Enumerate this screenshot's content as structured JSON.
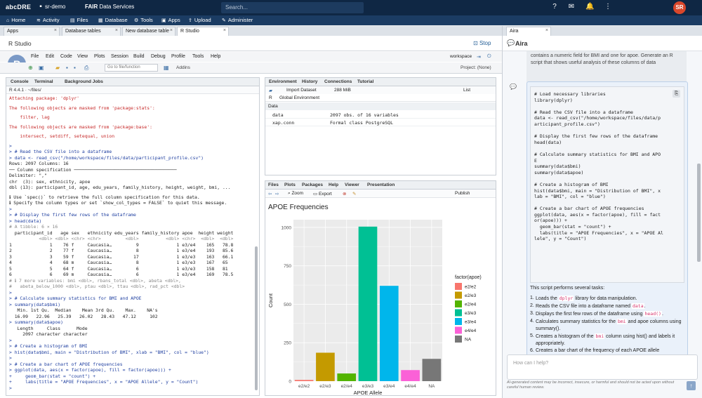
{
  "topbar": {
    "logo": "abcDRE",
    "crumb": "sr-demo",
    "fair_badge": "FAIR",
    "fair_label": "Data Services",
    "search_placeholder": "Search...",
    "avatar_initials": "SR"
  },
  "nav": {
    "items": [
      {
        "label": "Home",
        "icon": "home-icon"
      },
      {
        "label": "Activity",
        "icon": "activity-icon"
      },
      {
        "label": "Files",
        "icon": "files-icon"
      },
      {
        "label": "Database",
        "icon": "database-icon"
      },
      {
        "label": "Tools",
        "icon": "tools-icon"
      },
      {
        "label": "Apps",
        "icon": "apps-icon"
      },
      {
        "label": "Upload",
        "icon": "upload-icon"
      },
      {
        "label": "Administer",
        "icon": "administer-icon"
      }
    ]
  },
  "tabs": [
    {
      "label": "Apps"
    },
    {
      "label": "Database tables"
    },
    {
      "label": "New database table"
    },
    {
      "label": "R Studio"
    }
  ],
  "rstudio": {
    "title": "R Studio",
    "stop_label": "Stop",
    "menu": [
      "File",
      "Edit",
      "Code",
      "View",
      "Plots",
      "Session",
      "Build",
      "Debug",
      "Profile",
      "Tools",
      "Help"
    ],
    "workspace_label": "workspace",
    "goto_placeholder": "Go to file/function",
    "addins_label": "Addins",
    "project_label": "Project: (None)"
  },
  "console": {
    "tabs": [
      "Console",
      "Terminal",
      "Background Jobs"
    ],
    "path": "R 4.4.1 · ~/files/",
    "lines": [
      {
        "t": "Attaching package: 'dplyr'",
        "c": "red"
      },
      {
        "t": "",
        "c": "blank"
      },
      {
        "t": "The following objects are masked from 'package:stats':",
        "c": "red"
      },
      {
        "t": "",
        "c": "blank"
      },
      {
        "t": "    filter, lag",
        "c": "red"
      },
      {
        "t": "",
        "c": "blank"
      },
      {
        "t": "The following objects are masked from 'package:base':",
        "c": "red"
      },
      {
        "t": "",
        "c": "blank"
      },
      {
        "t": "    intersect, setdiff, setequal, union",
        "c": "red"
      },
      {
        "t": "",
        "c": "blank"
      },
      {
        "t": ">",
        "c": "blue"
      },
      {
        "t": "> # Read the CSV file into a dataframe",
        "c": "blue"
      },
      {
        "t": "> data <- read_csv(\"/home/workspace/files/data/participant_profile.csv\")",
        "c": "blue"
      },
      {
        "t": "Rows: 2097 Columns: 16",
        "c": "plain"
      },
      {
        "t": "── Column specification ──────────────────────────────────────",
        "c": "plain"
      },
      {
        "t": "Delimiter: \",\"",
        "c": "plain"
      },
      {
        "t": "chr  (3): sex, ethnicity, apoe",
        "c": "plain"
      },
      {
        "t": "dbl (13): participant_id, age, edu_years, family_history, height, weight, bmi, ...",
        "c": "plain"
      },
      {
        "t": "",
        "c": "blank"
      },
      {
        "t": "ℹ Use `spec()` to retrieve the full column specification for this data.",
        "c": "plain"
      },
      {
        "t": "ℹ Specify the column types or set `show_col_types = FALSE` to quiet this message.",
        "c": "plain"
      },
      {
        "t": ">",
        "c": "blue"
      },
      {
        "t": "> # Display the first few rows of the dataframe",
        "c": "blue"
      },
      {
        "t": "> head(data)",
        "c": "blue"
      },
      {
        "t": "# A tibble: 6 × 16",
        "c": "dim"
      },
      {
        "t": "  participant_id   age sex   ethnicity edu_years family_history apoe  height weight",
        "c": "plain"
      },
      {
        "t": "           <dbl> <dbl> <chr> <chr>         <dbl>          <dbl> <chr>  <dbl>  <dbl>",
        "c": "dim"
      },
      {
        "t": "1              1    76 f     Caucasia…         9              1 e3/e4    165   78.8",
        "c": "plain"
      },
      {
        "t": "2              2    77 f     Caucasia…         8              1 e3/e4    193   85.6",
        "c": "plain"
      },
      {
        "t": "3              3    59 f     Caucasia…        17              1 e3/e3    163   66.1",
        "c": "plain"
      },
      {
        "t": "4              4    68 m     Caucasia…         8              1 e3/e3    167   65",
        "c": "plain"
      },
      {
        "t": "5              5    64 f     Caucasia…         6              1 e3/e3    158   81",
        "c": "plain"
      },
      {
        "t": "6              6    69 m     Caucasia…         6              1 e3/e4    169   78.5",
        "c": "plain"
      },
      {
        "t": "# ℹ 7 more variables: bmi <dbl>, rbans_total <dbl>, abeta <dbl>,",
        "c": "dim"
      },
      {
        "t": "#   abeta_below_1000 <dbl>, ptau <dbl>, ttau <dbl>, rad_pct <dbl>",
        "c": "dim"
      },
      {
        "t": ">",
        "c": "blue"
      },
      {
        "t": "> # Calculate summary statistics for BMI and APOE",
        "c": "blue"
      },
      {
        "t": "> summary(data$bmi)",
        "c": "blue"
      },
      {
        "t": "   Min. 1st Qu.  Median    Mean 3rd Qu.    Max.    NA's",
        "c": "plain"
      },
      {
        "t": "  16.09   22.96   25.39   26.02   28.43   47.12     102",
        "c": "plain"
      },
      {
        "t": "> summary(data$apoe)",
        "c": "blue"
      },
      {
        "t": "   Length     Class      Mode",
        "c": "plain"
      },
      {
        "t": "     2097 character character",
        "c": "plain"
      },
      {
        "t": ">",
        "c": "blue"
      },
      {
        "t": "> # Create a histogram of BMI",
        "c": "blue"
      },
      {
        "t": "> hist(data$bmi, main = \"Distribution of BMI\", xlab = \"BMI\", col = \"blue\")",
        "c": "blue"
      },
      {
        "t": ">",
        "c": "blue"
      },
      {
        "t": "> # Create a bar chart of APOE frequencies",
        "c": "blue"
      },
      {
        "t": "> ggplot(data, aes(x = factor(apoe), fill = factor(apoe))) +",
        "c": "blue"
      },
      {
        "t": "+     geom_bar(stat = \"count\") +",
        "c": "blue"
      },
      {
        "t": "+     labs(title = \"APOE Frequencies\", x = \"APOE Allele\", y = \"Count\")",
        "c": "blue"
      },
      {
        "t": ">",
        "c": "blue"
      }
    ]
  },
  "env": {
    "tabs": [
      "Environment",
      "History",
      "Connections",
      "Tutorial"
    ],
    "import_label": "Import Dataset",
    "memory_label": "288 MiB",
    "list_label": "List",
    "r_label": "R",
    "global_env_label": "Global Environment",
    "section": "Data",
    "rows": [
      {
        "name": "data",
        "value": "2097 obs. of 16 variables"
      },
      {
        "name": "xap.conn",
        "value": "Formal class  PostgreSQL"
      }
    ]
  },
  "plots": {
    "tabs": [
      "Files",
      "Plots",
      "Packages",
      "Help",
      "Viewer",
      "Presentation"
    ],
    "zoom_label": "Zoom",
    "export_label": "Export",
    "publish_label": "Publish"
  },
  "chart_data": {
    "type": "bar",
    "title": "APOE Frequencies",
    "xlabel": "APOE Allele",
    "ylabel": "Count",
    "categories": [
      "e2/e2",
      "e2/e3",
      "e2/e4",
      "e3/e3",
      "e3/e4",
      "e4/e4",
      "NA"
    ],
    "values": [
      8,
      185,
      50,
      1005,
      620,
      72,
      145
    ],
    "colors": [
      "#F8766D",
      "#C49A00",
      "#53B400",
      "#00C094",
      "#00B6EB",
      "#FB61D7",
      "#777777"
    ],
    "ylim": [
      0,
      1050
    ],
    "yticks": [
      0,
      250,
      500,
      750,
      1000
    ],
    "legend_title": "factor(apoe)",
    "legend_position": "right",
    "grid": true
  },
  "aira": {
    "tab_label": "Aira",
    "title": "Aira",
    "prev_message": "contains a numeric field for BMI and one for apoe. Generate an R script that shows useful analysis of these columns of data",
    "code": [
      "# Load necessary libraries",
      "library(dplyr)",
      "",
      "# Read the CSV file into a dataframe",
      "data <- read_csv(\"/home/workspace/files/data/p",
      "articipant_profile.csv\")",
      "",
      "# Display the first few rows of the dataframe",
      "head(data)",
      "",
      "# Calculate summary statistics for BMI and APO",
      "E",
      "summary(data$bmi)",
      "summary(data$apoe)",
      "",
      "# Create a histogram of BMI",
      "hist(data$bmi, main = \"Distribution of BMI\", x",
      "lab = \"BMI\", col = \"blue\")",
      "",
      "# Create a bar chart of APOE frequencies",
      "ggplot(data, aes(x = factor(apoe), fill = fact",
      "or(apoe))) +",
      "  geom_bar(stat = \"count\") +",
      "  labs(title = \"APOE Frequencies\", x = \"APOE Al",
      "lele\", y = \"Count\")"
    ],
    "intro": "This script performs several tasks:",
    "steps": [
      {
        "num": "1.",
        "pre": "Loads the ",
        "code": "dplyr",
        "post": " library for data manipulation."
      },
      {
        "num": "2.",
        "pre": "Reads the CSV file into a dataframe named ",
        "code": "data",
        "post": "."
      },
      {
        "num": "3.",
        "pre": "Displays the first few rows of the dataframe using ",
        "code": "head()",
        "post": "."
      },
      {
        "num": "4.",
        "pre": "Calculates summary statistics for the ",
        "code": "bmi",
        "post": " and apoe columns using summary()."
      },
      {
        "num": "5.",
        "pre": "Creates a histogram of the ",
        "code": "bmi",
        "post": " column using hist() and labels it appropriately."
      },
      {
        "num": "6.",
        "pre": "Creates a bar chart of the frequency of each APOE allele",
        "code": "",
        "post": ""
      }
    ],
    "input_placeholder": "How can I help?",
    "disclaimer": "AI-generated content may be incorrect, insecure, or harmful and should not be acted upon without careful human review."
  }
}
